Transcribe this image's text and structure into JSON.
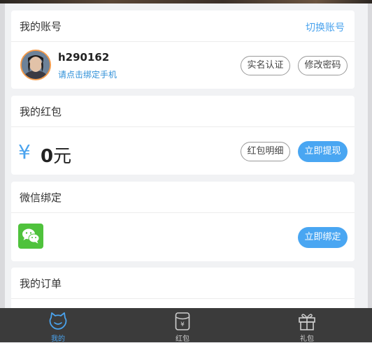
{
  "account": {
    "title": "我的账号",
    "switch_label": "切换账号",
    "username": "h290162",
    "bind_phone": "请点击绑定手机",
    "verify_label": "实名认证",
    "change_pwd_label": "修改密码"
  },
  "red_packet": {
    "title": "我的红包",
    "currency_symbol": "¥",
    "amount": "0",
    "unit": "元",
    "detail_label": "红包明细",
    "withdraw_label": "立即提现"
  },
  "wechat": {
    "title": "微信绑定",
    "bind_label": "立即绑定"
  },
  "orders": {
    "title": "我的订单"
  },
  "tabbar": {
    "tabs": [
      {
        "label": "我的",
        "icon": "cat-face-icon",
        "active": true
      },
      {
        "label": "红包",
        "icon": "red-packet-icon",
        "active": false
      },
      {
        "label": "礼包",
        "icon": "gift-icon",
        "active": false
      }
    ]
  },
  "colors": {
    "accent": "#49a6f2",
    "link": "#2f90d8",
    "tabbar_bg": "#3b3b3b",
    "wechat_green": "#4fc23c"
  }
}
